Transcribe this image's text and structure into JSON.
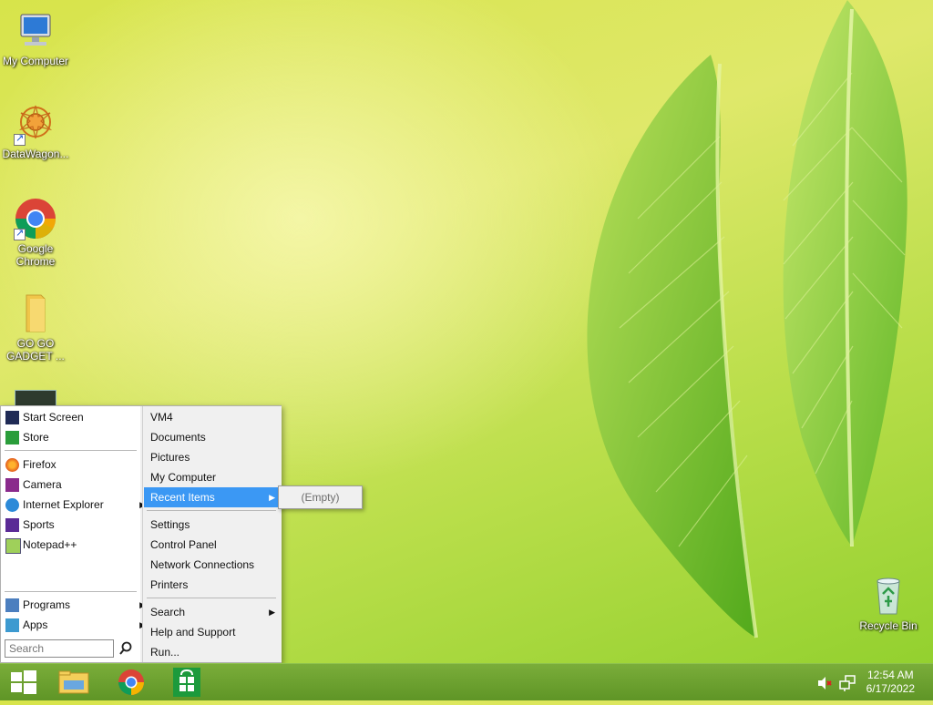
{
  "desktop": {
    "icons": [
      {
        "label": "My Computer"
      },
      {
        "label": "DataWagon..."
      },
      {
        "label": "Google Chrome"
      },
      {
        "label": "GO GO GADGET ..."
      },
      {
        "label": "Recycle Bin"
      }
    ]
  },
  "start_menu": {
    "left_top": [
      "Start Screen",
      "Store"
    ],
    "left_apps": [
      "Firefox",
      "Camera",
      "Internet Explorer",
      "Sports",
      "Notepad++"
    ],
    "left_bottom": [
      "Programs",
      "Apps"
    ],
    "search_placeholder": "Search",
    "right_group1": [
      "VM4",
      "Documents",
      "Pictures",
      "My Computer",
      "Recent Items"
    ],
    "right_group2": [
      "Settings",
      "Control Panel",
      "Network Connections",
      "Printers"
    ],
    "right_group3": [
      "Search",
      "Help and Support",
      "Run..."
    ],
    "submenu_empty": "(Empty)"
  },
  "taskbar": {
    "time": "12:54 AM",
    "date": "6/17/2022"
  },
  "colors": {
    "highlight": "#3b98f4",
    "taskbar": "#6aa030"
  }
}
